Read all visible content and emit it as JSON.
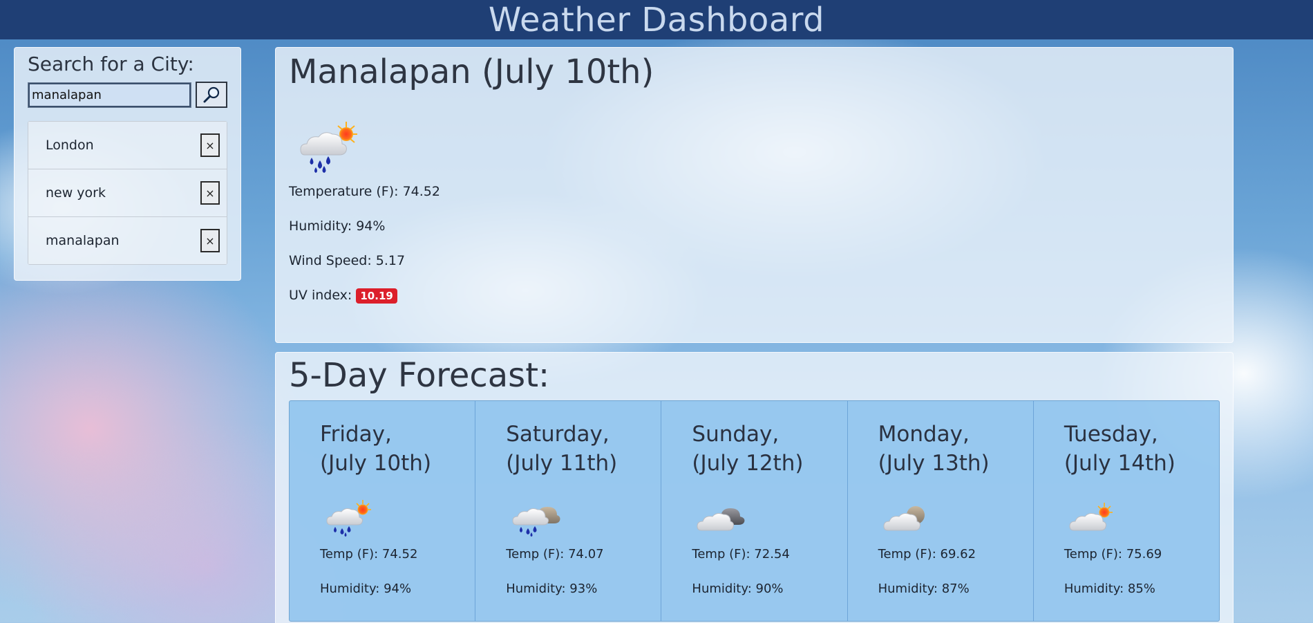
{
  "header": {
    "title": "Weather Dashboard"
  },
  "search": {
    "label": "Search for a City:",
    "value": "manalapan",
    "history": [
      {
        "label": "London",
        "close_label": "×"
      },
      {
        "label": "new york",
        "close_label": "×"
      },
      {
        "label": "manalapan",
        "close_label": "×"
      }
    ]
  },
  "current": {
    "title": "Manalapan (July 10th)",
    "icon": "rain-sun-icon",
    "temperature": "Temperature (F): 74.52",
    "humidity": "Humidity: 94%",
    "wind": "Wind Speed: 5.17",
    "uv_label": "UV index:",
    "uv_value": "10.19",
    "uv_color": "#dc1f2b"
  },
  "forecast": {
    "title": "5-Day Forecast:",
    "days": [
      {
        "day": "Friday,",
        "date": "(July 10th)",
        "icon": "rain-sun-icon",
        "temp": "Temp (F): 74.52",
        "humidity": "Humidity: 94%"
      },
      {
        "day": "Saturday,",
        "date": "(July 11th)",
        "icon": "rain-cloud-icon",
        "temp": "Temp (F): 74.07",
        "humidity": "Humidity: 93%"
      },
      {
        "day": "Sunday,",
        "date": "(July 12th)",
        "icon": "overcast-icon",
        "temp": "Temp (F): 72.54",
        "humidity": "Humidity: 90%"
      },
      {
        "day": "Monday,",
        "date": "(July 13th)",
        "icon": "cloudy-icon",
        "temp": "Temp (F): 69.62",
        "humidity": "Humidity: 87%"
      },
      {
        "day": "Tuesday,",
        "date": "(July 14th)",
        "icon": "partly-sunny-icon",
        "temp": "Temp (F): 75.69",
        "humidity": "Humidity: 85%"
      }
    ]
  }
}
